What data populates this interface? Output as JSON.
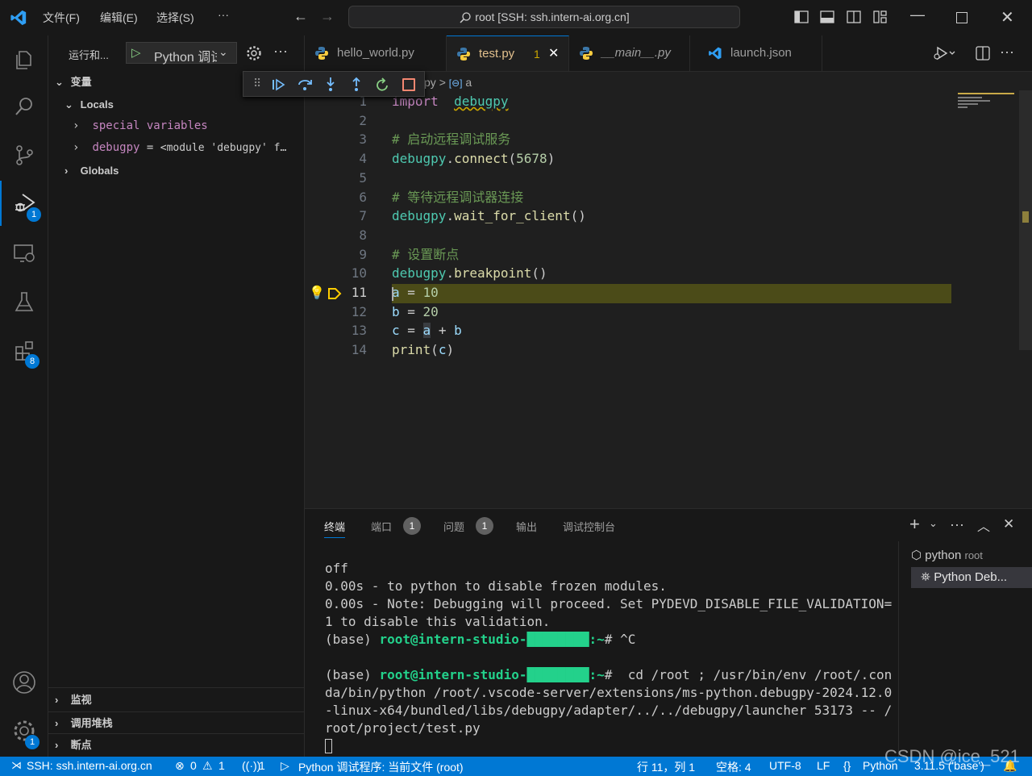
{
  "titlebar": {
    "menus": [
      "文件(F)",
      "编辑(E)",
      "选择(S)",
      "···"
    ],
    "command_center": "root [SSH: ssh.intern-ai.org.cn]"
  },
  "activity": {
    "debug_badge": "1",
    "extensions_badge": "8",
    "settings_badge": "1"
  },
  "sidebar": {
    "run_label": "运行和...",
    "config_name": "Python 调试",
    "variables_header": "变量",
    "locals_label": "Locals",
    "special_vars": "special variables",
    "debugpy_var_name": "debugpy",
    "debugpy_var_eq": " = ",
    "debugpy_var_val": "<module 'debugpy' f…",
    "globals_label": "Globals",
    "watch_header": "监视",
    "callstack_header": "调用堆栈",
    "breakpoints_header": "断点"
  },
  "tabs": [
    {
      "label": "hello_world.py"
    },
    {
      "label": "test.py",
      "problems": "1"
    },
    {
      "label": "__main__.py"
    },
    {
      "label": "launch.json"
    }
  ],
  "breadcrumb": {
    "file": "py",
    "sep": ">",
    "symbol": "a"
  },
  "code_lines": [
    {
      "n": "1",
      "segs": [
        [
          "kw",
          "import"
        ],
        [
          "",
          "  "
        ],
        [
          "mod",
          "debugpy"
        ]
      ]
    },
    {
      "n": "2",
      "segs": []
    },
    {
      "n": "3",
      "segs": [
        [
          "cm",
          "# 启动远程调试服务"
        ]
      ]
    },
    {
      "n": "4",
      "segs": [
        [
          "mod",
          "debugpy"
        ],
        [
          "",
          "."
        ],
        [
          "fn",
          "connect"
        ],
        [
          "",
          "("
        ],
        [
          "num",
          "5678"
        ],
        [
          "",
          ")"
        ]
      ]
    },
    {
      "n": "5",
      "segs": []
    },
    {
      "n": "6",
      "segs": [
        [
          "cm",
          "# 等待远程调试器连接"
        ]
      ]
    },
    {
      "n": "7",
      "segs": [
        [
          "mod",
          "debugpy"
        ],
        [
          "",
          "."
        ],
        [
          "fn",
          "wait_for_client"
        ],
        [
          "",
          "()"
        ]
      ]
    },
    {
      "n": "8",
      "segs": []
    },
    {
      "n": "9",
      "segs": [
        [
          "cm",
          "# 设置断点"
        ]
      ]
    },
    {
      "n": "10",
      "segs": [
        [
          "mod",
          "debugpy"
        ],
        [
          "",
          "."
        ],
        [
          "fn",
          "breakpoint"
        ],
        [
          "",
          "()"
        ]
      ]
    },
    {
      "n": "11",
      "segs": [
        [
          "var",
          "a"
        ],
        [
          "",
          " = "
        ],
        [
          "num",
          "10"
        ]
      ]
    },
    {
      "n": "12",
      "segs": [
        [
          "var",
          "b"
        ],
        [
          "",
          " = "
        ],
        [
          "num",
          "20"
        ]
      ]
    },
    {
      "n": "13",
      "segs": [
        [
          "var",
          "c"
        ],
        [
          "",
          " = "
        ],
        [
          "var",
          "a"
        ],
        [
          "",
          " + "
        ],
        [
          "var",
          "b"
        ]
      ]
    },
    {
      "n": "14",
      "segs": [
        [
          "fn",
          "print"
        ],
        [
          "",
          "("
        ],
        [
          "var",
          "c"
        ],
        [
          "",
          ")"
        ]
      ]
    }
  ],
  "current_line": "11",
  "panel": {
    "tabs": [
      "终端",
      "端口",
      "问题",
      "输出",
      "调试控制台"
    ],
    "ports_badge": "1",
    "problems_badge": "1",
    "terminals": [
      "python",
      "root",
      "Python Deb..."
    ],
    "terminal_lines": [
      "off",
      "0.00s - to python to disable frozen modules.",
      "0.00s - Note: Debugging will proceed. Set PYDEVD_DISABLE_FILE_VALIDATION=",
      "1 to disable this validation.",
      "(base) root@intern-studio-████████:~# ^C",
      "",
      "(base) root@intern-studio-████████:~#  cd /root ; /usr/bin/env /root/.con",
      "da/bin/python /root/.vscode-server/extensions/ms-python.debugpy-2024.12.0",
      "-linux-x64/bundled/libs/debugpy/adapter/../../debugpy/launcher 53173 -- /",
      "root/project/test.py"
    ]
  },
  "status": {
    "remote": "SSH: ssh.intern-ai.org.cn",
    "errors": "0",
    "warnings": "1",
    "ports": "1",
    "debug": "Python 调试程序: 当前文件 (root)",
    "position": "行 11，列 1",
    "spaces": "空格: 4",
    "encoding": "UTF-8",
    "eol": "LF",
    "language": "Python",
    "interpreter": "3.11.5 ('base')"
  },
  "watermark": "CSDN @ice_521",
  "colors": {
    "accent": "#0078d4",
    "current_line": "#4b4b18",
    "breakpoint_arrow": "#ffcc00"
  }
}
